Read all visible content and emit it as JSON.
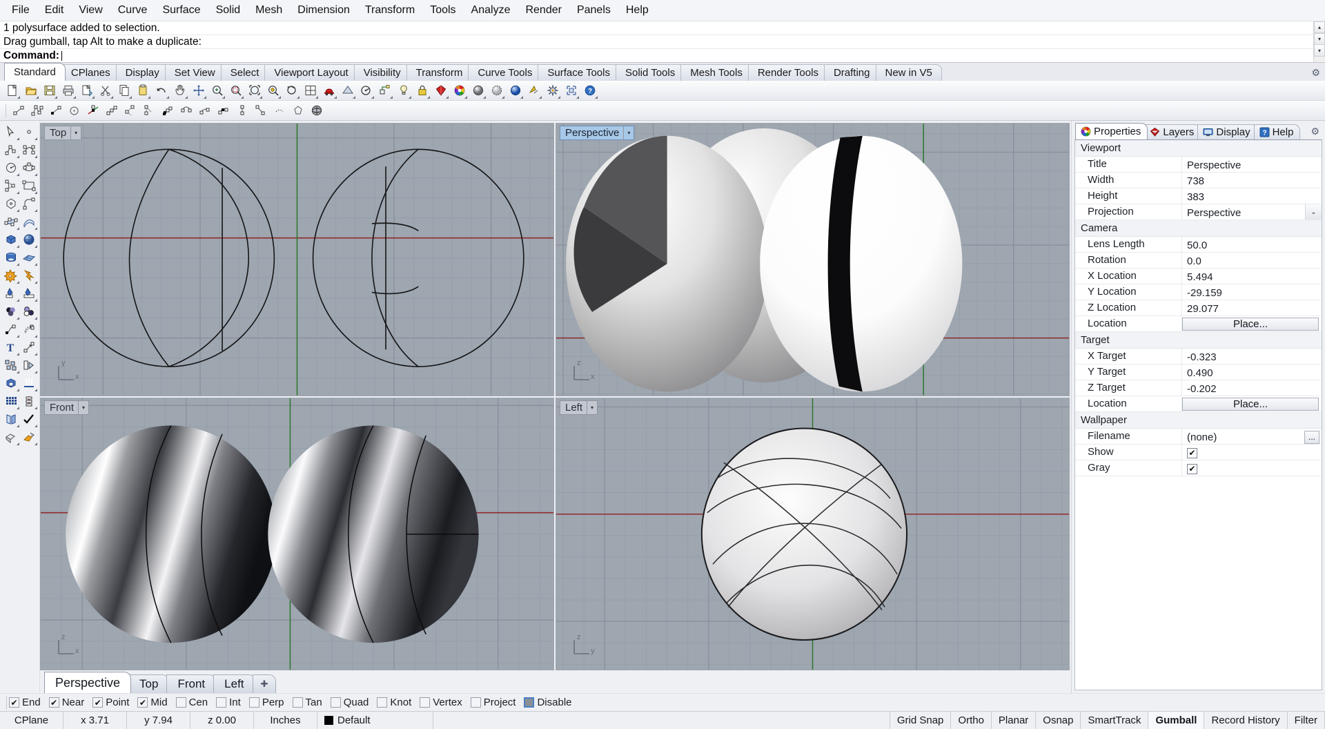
{
  "menu": {
    "items": [
      "File",
      "Edit",
      "View",
      "Curve",
      "Surface",
      "Solid",
      "Mesh",
      "Dimension",
      "Transform",
      "Tools",
      "Analyze",
      "Render",
      "Panels",
      "Help"
    ]
  },
  "command": {
    "history": [
      "1 polysurface added to selection.",
      "Drag gumball, tap Alt to make a duplicate:"
    ],
    "prompt_label": "Command:",
    "prompt_value": "",
    "scroll_up": "▴",
    "scroll_down": "▾"
  },
  "toolbar_tabs": {
    "items": [
      "Standard",
      "CPlanes",
      "Display",
      "Set View",
      "Select",
      "Viewport Layout",
      "Visibility",
      "Transform",
      "Curve Tools",
      "Surface Tools",
      "Solid Tools",
      "Mesh Tools",
      "Render Tools",
      "Drafting",
      "New in V5"
    ],
    "active": "Standard",
    "options_icon": "gear-icon"
  },
  "toolbar_row1": [
    {
      "name": "new-file-icon"
    },
    {
      "name": "open-file-icon"
    },
    {
      "name": "save-file-icon"
    },
    {
      "name": "print-icon"
    },
    {
      "name": "cut-copy-icon"
    },
    {
      "name": "scissors-cut-icon"
    },
    {
      "name": "copy-icon"
    },
    {
      "name": "paste-icon"
    },
    {
      "name": "undo-icon"
    },
    {
      "name": "pan-hand-icon"
    },
    {
      "name": "move-icon"
    },
    {
      "name": "zoom-in-icon"
    },
    {
      "name": "zoom-window-icon"
    },
    {
      "name": "zoom-extents-icon"
    },
    {
      "name": "zoom-selected-icon"
    },
    {
      "name": "zoom-dynamic-icon"
    },
    {
      "name": "grid-icon"
    },
    {
      "name": "car-render-icon"
    },
    {
      "name": "render-preview-icon"
    },
    {
      "name": "analyze-direction-icon"
    },
    {
      "name": "curvature-icon"
    },
    {
      "name": "light-icon"
    },
    {
      "name": "lock-icon"
    },
    {
      "name": "layer-color-icon"
    },
    {
      "name": "color-wheel-icon"
    },
    {
      "name": "shade-sphere-icon"
    },
    {
      "name": "ghosted-sphere-icon"
    },
    {
      "name": "render-sphere-icon"
    },
    {
      "name": "named-view-icon"
    },
    {
      "name": "options-gear-icon"
    },
    {
      "name": "properties-icon"
    },
    {
      "name": "help-question-icon"
    }
  ],
  "toolbar_row2": [
    {
      "name": "line-icon"
    },
    {
      "name": "polyline-icon"
    },
    {
      "name": "line-segment-icon"
    },
    {
      "name": "circle-icon"
    },
    {
      "name": "cplane-axis-icon"
    },
    {
      "name": "polyline-pts-icon"
    },
    {
      "name": "line-tangent-icon"
    },
    {
      "name": "angle-line-icon"
    },
    {
      "name": "point-cloud-icon"
    },
    {
      "name": "arc-icon"
    },
    {
      "name": "arc-center-icon"
    },
    {
      "name": "arc-3pt-icon"
    },
    {
      "name": "vertical-line-icon"
    },
    {
      "name": "line-perp-icon"
    },
    {
      "name": "curve-dash-icon"
    },
    {
      "name": "polygon-icon"
    },
    {
      "name": "sphere-wire-icon"
    }
  ],
  "side_tools": [
    {
      "name": "select-arrow-icon"
    },
    {
      "name": "point-object-icon"
    },
    {
      "name": "polyline-icon"
    },
    {
      "name": "control-point-curve-icon"
    },
    {
      "name": "circle-icon"
    },
    {
      "name": "ellipse-icon"
    },
    {
      "name": "arc-icon"
    },
    {
      "name": "rectangle-icon"
    },
    {
      "name": "polygon-icon"
    },
    {
      "name": "curve-fillet-icon"
    },
    {
      "name": "surface-control-points-icon"
    },
    {
      "name": "surface-sweep-icon"
    },
    {
      "name": "box-solid-icon"
    },
    {
      "name": "sphere-solid-icon"
    },
    {
      "name": "cylinder-solid-icon"
    },
    {
      "name": "mesh-plane-icon"
    },
    {
      "name": "boolean-union-icon"
    },
    {
      "name": "explode-icon"
    },
    {
      "name": "trim-icon"
    },
    {
      "name": "split-icon"
    },
    {
      "name": "layer-color-icon"
    },
    {
      "name": "object-color-icon"
    },
    {
      "name": "curve-blend-icon"
    },
    {
      "name": "curve-offset-icon"
    },
    {
      "name": "text-icon"
    },
    {
      "name": "dimension-icon"
    },
    {
      "name": "group-icon"
    },
    {
      "name": "rotate-copy-icon"
    },
    {
      "name": "cap-solid-icon"
    },
    {
      "name": "extrude-icon"
    },
    {
      "name": "array-icon"
    },
    {
      "name": "array-curve-icon"
    },
    {
      "name": "mirror-icon"
    },
    {
      "name": "check-objects-icon"
    },
    {
      "name": "shade-icon"
    },
    {
      "name": "render-icon"
    }
  ],
  "viewports": [
    {
      "id": "top",
      "label": "Top",
      "active": false,
      "arrow": "▾",
      "axes": {
        "v": "y",
        "h": "x"
      }
    },
    {
      "id": "perspective",
      "label": "Perspective",
      "active": true,
      "arrow": "▾",
      "axes": {
        "v": "z",
        "h": "x"
      }
    },
    {
      "id": "front",
      "label": "Front",
      "active": false,
      "arrow": "▾",
      "axes": {
        "v": "z",
        "h": "x"
      }
    },
    {
      "id": "left",
      "label": "Left",
      "active": false,
      "arrow": "▾",
      "axes": {
        "v": "z",
        "h": "y"
      }
    }
  ],
  "viewport_tabs": {
    "items": [
      "Perspective",
      "Top",
      "Front",
      "Left"
    ],
    "active": "Perspective",
    "add_label": "✚"
  },
  "panel": {
    "tabs": [
      {
        "label": "Properties",
        "icon": "color-wheel-icon",
        "active": true
      },
      {
        "label": "Layers",
        "icon": "layers-icon",
        "active": false
      },
      {
        "label": "Display",
        "icon": "monitor-icon",
        "active": false
      },
      {
        "label": "Help",
        "icon": "help-question-icon",
        "active": false
      }
    ],
    "options_icon": "gear-icon",
    "groups": [
      {
        "title": "Viewport",
        "rows": [
          {
            "key": "Title",
            "value": "Perspective",
            "type": "text"
          },
          {
            "key": "Width",
            "value": "738",
            "type": "text"
          },
          {
            "key": "Height",
            "value": "383",
            "type": "text"
          },
          {
            "key": "Projection",
            "value": "Perspective",
            "type": "dropdown",
            "chevron": "⌄"
          }
        ]
      },
      {
        "title": "Camera",
        "rows": [
          {
            "key": "Lens Length",
            "value": "50.0",
            "type": "text"
          },
          {
            "key": "Rotation",
            "value": "0.0",
            "type": "text"
          },
          {
            "key": "X Location",
            "value": "5.494",
            "type": "text"
          },
          {
            "key": "Y Location",
            "value": "-29.159",
            "type": "text"
          },
          {
            "key": "Z Location",
            "value": "29.077",
            "type": "text"
          },
          {
            "key": "Location",
            "value": "Place...",
            "type": "button"
          }
        ]
      },
      {
        "title": "Target",
        "rows": [
          {
            "key": "X Target",
            "value": "-0.323",
            "type": "text"
          },
          {
            "key": "Y Target",
            "value": "0.490",
            "type": "text"
          },
          {
            "key": "Z Target",
            "value": "-0.202",
            "type": "text"
          },
          {
            "key": "Location",
            "value": "Place...",
            "type": "button"
          }
        ]
      },
      {
        "title": "Wallpaper",
        "rows": [
          {
            "key": "Filename",
            "value": "(none)",
            "type": "file",
            "browse": "..."
          },
          {
            "key": "Show",
            "value": "",
            "type": "checkbox",
            "checked": true
          },
          {
            "key": "Gray",
            "value": "",
            "type": "checkbox",
            "checked": true
          }
        ]
      }
    ]
  },
  "osnap": {
    "items": [
      {
        "label": "End",
        "checked": true
      },
      {
        "label": "Near",
        "checked": true
      },
      {
        "label": "Point",
        "checked": true
      },
      {
        "label": "Mid",
        "checked": true
      },
      {
        "label": "Cen",
        "checked": false
      },
      {
        "label": "Int",
        "checked": false
      },
      {
        "label": "Perp",
        "checked": false
      },
      {
        "label": "Tan",
        "checked": false
      },
      {
        "label": "Quad",
        "checked": false
      },
      {
        "label": "Knot",
        "checked": false
      },
      {
        "label": "Vertex",
        "checked": false
      },
      {
        "label": "Project",
        "checked": false
      },
      {
        "label": "Disable",
        "checked": false,
        "style": "disable"
      }
    ],
    "check_glyph": "✔"
  },
  "statusbar": {
    "cplane": "CPlane",
    "x": "x 3.71",
    "y": "y 7.94",
    "z": "z 0.00",
    "units": "Inches",
    "layer": "Default",
    "layer_color": "#000000",
    "toggles": [
      {
        "label": "Grid Snap",
        "active": false
      },
      {
        "label": "Ortho",
        "active": false
      },
      {
        "label": "Planar",
        "active": false
      },
      {
        "label": "Osnap",
        "active": false
      },
      {
        "label": "SmartTrack",
        "active": false
      },
      {
        "label": "Gumball",
        "active": true
      },
      {
        "label": "Record History",
        "active": false
      },
      {
        "label": "Filter",
        "active": false
      }
    ]
  },
  "colors": {
    "viewport_bg": "#9ea6b0",
    "grid_line": "#8d95a1",
    "axis_x": "#8f2b2b",
    "axis_y": "#2d7a2d",
    "accent_tab": "#a8c8e8"
  }
}
